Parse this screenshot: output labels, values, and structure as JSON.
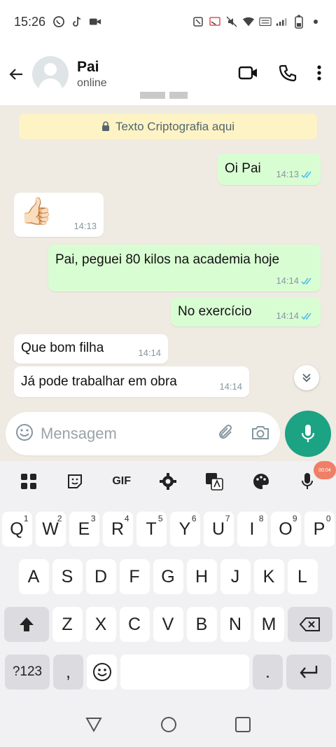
{
  "status_bar": {
    "time": "15:26"
  },
  "header": {
    "name": "Pai",
    "status": "online"
  },
  "chat": {
    "encryption_notice": "Texto Criptografia aqui",
    "messages": [
      {
        "dir": "out",
        "text": "Oi Pai",
        "time": "14:13",
        "read": true
      },
      {
        "dir": "in",
        "text": "👍🏻",
        "time": "14:13"
      },
      {
        "dir": "out",
        "text": "Pai, peguei 80 kilos na academia hoje",
        "time": "14:14",
        "read": true
      },
      {
        "dir": "out",
        "text": "No exercício",
        "time": "14:14",
        "read": true
      },
      {
        "dir": "in",
        "text": "Que bom filha",
        "time": "14:14"
      },
      {
        "dir": "in",
        "text": "Já pode trabalhar em obra",
        "time": "14:14"
      }
    ]
  },
  "composer": {
    "placeholder": "Mensagem"
  },
  "keyboard": {
    "toolbar": {
      "gif_label": "GIF",
      "recording_badge": "00:04"
    },
    "row1": [
      {
        "k": "Q",
        "n": "1"
      },
      {
        "k": "W",
        "n": "2"
      },
      {
        "k": "E",
        "n": "3"
      },
      {
        "k": "R",
        "n": "4"
      },
      {
        "k": "T",
        "n": "5"
      },
      {
        "k": "Y",
        "n": "6"
      },
      {
        "k": "U",
        "n": "7"
      },
      {
        "k": "I",
        "n": "8"
      },
      {
        "k": "O",
        "n": "9"
      },
      {
        "k": "P",
        "n": "0"
      }
    ],
    "row2": [
      "A",
      "S",
      "D",
      "F",
      "G",
      "H",
      "J",
      "K",
      "L"
    ],
    "row3": [
      "Z",
      "X",
      "C",
      "V",
      "B",
      "N",
      "M"
    ],
    "bottom": {
      "symbols": "?123",
      "comma": ",",
      "period": "."
    }
  },
  "colors": {
    "accent": "#1ba384",
    "outgoing": "#d9fdd3",
    "incoming": "#ffffff",
    "read_ticks": "#53bdeb",
    "banner": "#fdf3c4"
  }
}
